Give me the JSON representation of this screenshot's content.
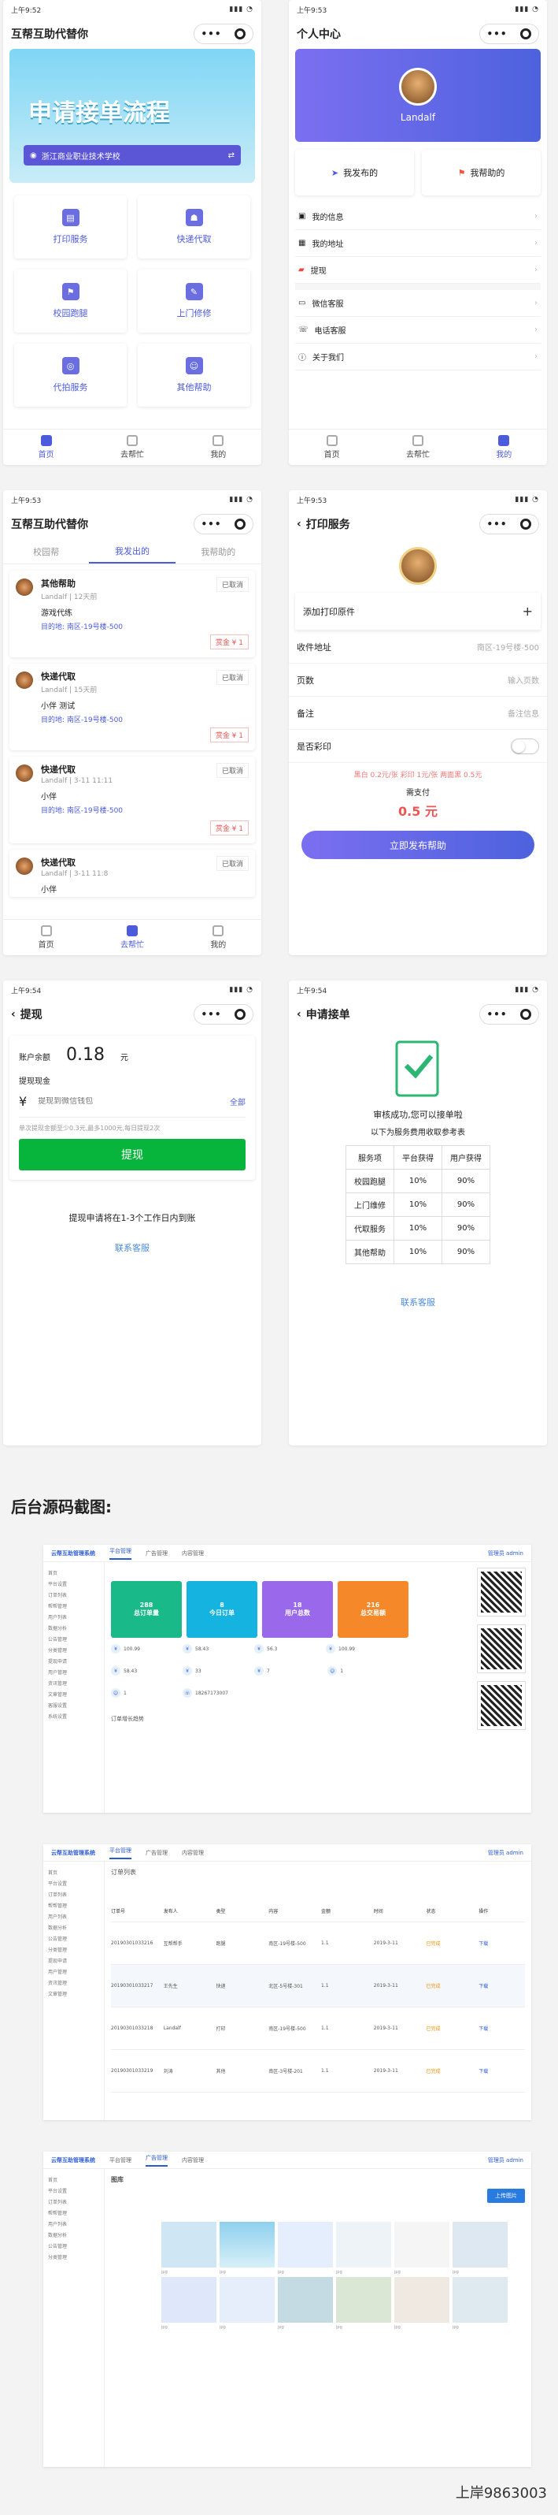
{
  "status": {
    "time1": "上午9:52",
    "time2": "上午9:53",
    "time3": "上午9:53",
    "time4": "上午9:53",
    "time5": "上午9:54",
    "time6": "上午9:54"
  },
  "capsule": {
    "dots": "•••",
    "ring": ""
  },
  "screen1": {
    "title": "互帮互助代替你",
    "banner_title": "申请接单流程",
    "school": "浙江商业职业技术学校",
    "services": [
      {
        "label": "打印服务",
        "icon": "printer-icon"
      },
      {
        "label": "快递代取",
        "icon": "package-icon"
      },
      {
        "label": "校园跑腿",
        "icon": "running-icon"
      },
      {
        "label": "上门修修",
        "icon": "wrench-icon"
      },
      {
        "label": "代拍服务",
        "icon": "camera-icon"
      },
      {
        "label": "其他帮助",
        "icon": "help-icon"
      }
    ],
    "tabs": [
      "首页",
      "去帮忙",
      "我的"
    ]
  },
  "screen2": {
    "title": "个人中心",
    "name": "Landalf",
    "btn_published": "我发布的",
    "btn_helped": "我帮助的",
    "menu": [
      "我的信息",
      "我的地址",
      "提现",
      "微信客服",
      "电话客服",
      "关于我们"
    ]
  },
  "screen3": {
    "title": "互帮互助代替你",
    "tabs": [
      "校园帮",
      "我发出的",
      "我帮助的"
    ],
    "orders": [
      {
        "type": "其他帮助",
        "user": "Landalf | 12天前",
        "desc": "游戏代练",
        "addr": "目的地: 南区-19号楼-500",
        "status": "已取消",
        "price": "赏金 ¥ 1"
      },
      {
        "type": "快递代取",
        "user": "Landalf | 15天前",
        "desc": "小伴 测试",
        "addr": "目的地: 南区-19号楼-500",
        "status": "已取消",
        "price": "赏金 ¥ 1"
      },
      {
        "type": "快递代取",
        "user": "Landalf | 3-11 11:11",
        "desc": "小伴",
        "addr": "目的地: 南区-19号楼-500",
        "status": "已取消",
        "price": "赏金 ¥ 1"
      },
      {
        "type": "快递代取",
        "user": "Landalf | 3-11 11:8",
        "desc": "小伴",
        "addr": "",
        "status": "已取消",
        "price": ""
      }
    ]
  },
  "screen4": {
    "title": "打印服务",
    "add_file": "添加打印原件",
    "addr_label": "收件地址",
    "addr_value": "南区-19号楼-500",
    "pages_label": "页数",
    "pages_value": "输入页数",
    "note_label": "备注",
    "note_value": "备注信息",
    "color_label": "是否彩印",
    "price_line": "黑白 0.2元/张  彩印 1元/张  两面黑 0.5元",
    "pay_label": "需支付",
    "pay_value": "0.5 元",
    "submit": "立即发布帮助"
  },
  "screen5": {
    "title": "提现",
    "balance_label": "账户余额",
    "balance": "0.18",
    "unit": "元",
    "wd_label": "提现现金",
    "currency": "¥",
    "placeholder": "提现到微信钱包",
    "all": "全部",
    "rule": "单次提现金额至少0.3元,最多1000元,每日提现2次",
    "btn": "提现",
    "tip": "提现申请将在1-3个工作日内到账",
    "service": "联系客服"
  },
  "screen6": {
    "title": "申请接单",
    "msg1": "审核成功,您可以接单啦",
    "msg2": "以下为服务费用收取参考表",
    "headers": [
      "服务项",
      "平台获得",
      "用户获得"
    ],
    "rows": [
      [
        "校园跑腿",
        "10%",
        "90%"
      ],
      [
        "上门维修",
        "10%",
        "90%"
      ],
      [
        "代取服务",
        "10%",
        "90%"
      ],
      [
        "其他帮助",
        "10%",
        "90%"
      ]
    ],
    "service": "联系客服"
  },
  "section_title": "后台源码截图:",
  "admin": {
    "logo": "云帮互助管理系统",
    "nav": [
      "平台管理",
      "广告管理",
      "内容管理"
    ],
    "user": "管理员 admin",
    "sidebar": [
      "首页",
      "平台设置",
      "订单列表",
      "帮帮管理",
      "用户列表",
      "数据分析",
      "公告管理",
      "分类管理",
      "提现申请",
      "用户管理",
      "资讯管理",
      "文章管理",
      "客服设置",
      "系统设置",
      "前端管理",
      "数据管理"
    ],
    "stats": [
      {
        "v": "288",
        "l": "总订单量",
        "c": "#19b98a"
      },
      {
        "v": "8",
        "l": "今日订单",
        "c": "#14b3e0"
      },
      {
        "v": "18",
        "l": "用户总数",
        "c": "#9a68ea"
      },
      {
        "v": "216",
        "l": "总交易额",
        "c": "#f5892a"
      }
    ],
    "kvs": [
      "100.99",
      "58.43",
      "56.3",
      "100.99",
      "58.43",
      "33",
      "7",
      "1",
      "1",
      "18267173007"
    ],
    "chart_label": "订单增长趋势",
    "list_title": "订单列表",
    "table_cols": [
      "订单号",
      "发布人",
      "类型",
      "内容",
      "金额",
      "时间",
      "状态",
      "操作"
    ],
    "table_rows": [
      [
        "20190301033216",
        "互帮帮手",
        "跑腿",
        "南区-19号楼-500",
        "1.1",
        "2019-3-11",
        "已完成",
        "下载"
      ],
      [
        "20190301033217",
        "王先生",
        "快递",
        "北区-5号楼-301",
        "1.1",
        "2019-3-11",
        "已完成",
        "下载"
      ],
      [
        "20190301033218",
        "Landalf",
        "打印",
        "南区-19号楼-500",
        "1.1",
        "2019-3-11",
        "已完成",
        "下载"
      ],
      [
        "20190301033219",
        "刘涛",
        "其他",
        "南区-3号楼-201",
        "1.1",
        "2019-3-11",
        "已完成",
        "下载"
      ]
    ],
    "gallery_title": "图库",
    "upload": "上传图片",
    "images": [
      "jpg",
      "jpg",
      "jpg",
      "jpg",
      "jpg",
      "jpg",
      "jpg",
      "jpg",
      "jpg",
      "jpg",
      "jpg",
      "jpg"
    ]
  },
  "watermark": "上岸9863003"
}
